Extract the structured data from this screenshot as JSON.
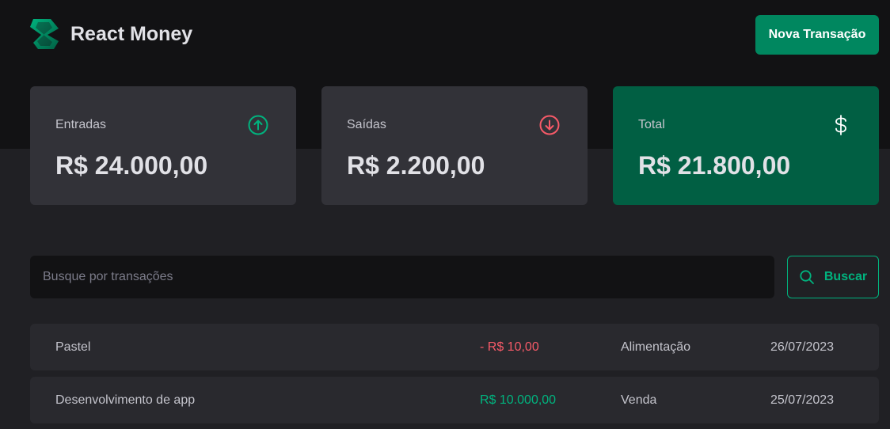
{
  "header": {
    "app_name": "React Money",
    "new_transaction_label": "Nova Transação",
    "logo_icon": "react-money-logo"
  },
  "summary": {
    "income": {
      "label": "Entradas",
      "value": "R$ 24.000,00",
      "icon": "arrow-circle-up-icon",
      "color": "#00b37e"
    },
    "outcome": {
      "label": "Saídas",
      "value": "R$ 2.200,00",
      "icon": "arrow-circle-down-icon",
      "color": "#f75a68"
    },
    "total": {
      "label": "Total",
      "value": "R$ 21.800,00",
      "icon": "currency-dollar-icon",
      "color": "#015f43"
    }
  },
  "search": {
    "placeholder": "Busque por transações",
    "value": "",
    "button_label": "Buscar",
    "button_icon": "magnifying-glass-icon"
  },
  "transactions": [
    {
      "description": "Pastel",
      "price": "- R$ 10,00",
      "type": "outcome",
      "category": "Alimentação",
      "date": "26/07/2023"
    },
    {
      "description": "Desenvolvimento de app",
      "price": "R$ 10.000,00",
      "type": "income",
      "category": "Venda",
      "date": "25/07/2023"
    }
  ],
  "colors": {
    "background": "#202024",
    "header_background": "#121214",
    "accent": "#00875f",
    "accent_light": "#00b37e",
    "danger": "#f75a68",
    "card": "#323238",
    "row": "#29292e"
  }
}
